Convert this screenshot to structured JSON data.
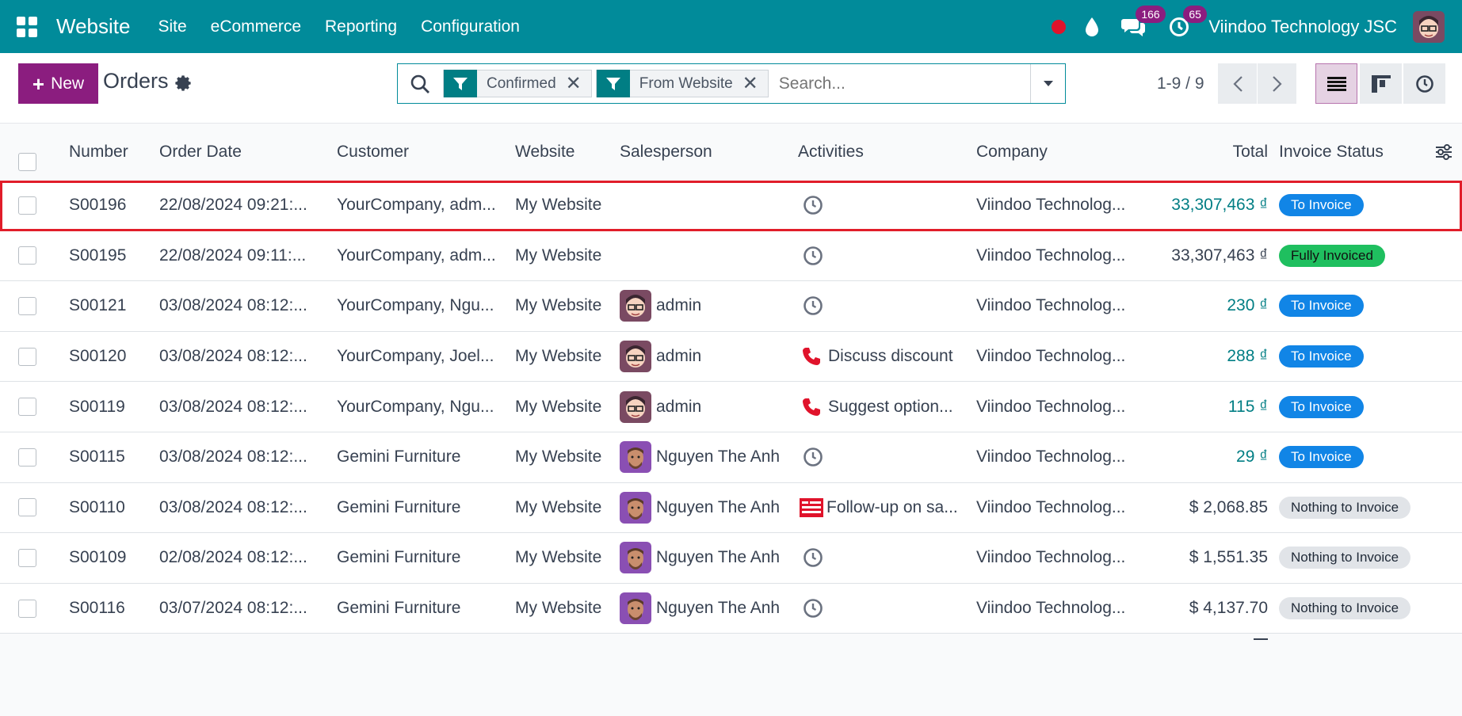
{
  "topbar": {
    "app_name": "Website",
    "menu": [
      "Site",
      "eCommerce",
      "Reporting",
      "Configuration"
    ],
    "messages_count": "166",
    "activities_count": "65",
    "company": "Viindoo Technology JSC",
    "brand_color": "#018b9a"
  },
  "control": {
    "new_label": "New",
    "title": "Orders",
    "facets": [
      "Confirmed",
      "From Website"
    ],
    "search_placeholder": "Search...",
    "pager": "1-9 / 9"
  },
  "table": {
    "headers": {
      "number": "Number",
      "order_date": "Order Date",
      "customer": "Customer",
      "website": "Website",
      "salesperson": "Salesperson",
      "activities": "Activities",
      "company": "Company",
      "total": "Total",
      "invoice_status": "Invoice Status"
    },
    "rows": [
      {
        "number": "S00196",
        "date": "22/08/2024 09:21:...",
        "customer": "YourCompany, adm...",
        "website": "My Website",
        "salesperson": "",
        "activity": "",
        "activity_icon": "clock-icon",
        "company": "Viindoo Technolog...",
        "total": "33,307,463 ₫",
        "total_link": true,
        "status": "To Invoice",
        "status_style": "blue",
        "highlight": true
      },
      {
        "number": "S00195",
        "date": "22/08/2024 09:11:...",
        "customer": "YourCompany, adm...",
        "website": "My Website",
        "salesperson": "",
        "activity": "",
        "activity_icon": "clock-icon",
        "company": "Viindoo Technolog...",
        "total": "33,307,463 ₫",
        "total_link": false,
        "status": "Fully Invoiced",
        "status_style": "green"
      },
      {
        "number": "S00121",
        "date": "03/08/2024 08:12:...",
        "customer": "YourCompany, Ngu...",
        "website": "My Website",
        "salesperson": "admin",
        "activity": "",
        "activity_icon": "clock-icon",
        "company": "Viindoo Technolog...",
        "total": "230 ₫",
        "total_link": true,
        "status": "To Invoice",
        "status_style": "blue"
      },
      {
        "number": "S00120",
        "date": "03/08/2024 08:12:...",
        "customer": "YourCompany, Joel...",
        "website": "My Website",
        "salesperson": "admin",
        "activity": "Discuss discount",
        "activity_icon": "phone-icon",
        "company": "Viindoo Technolog...",
        "total": "288 ₫",
        "total_link": true,
        "status": "To Invoice",
        "status_style": "blue"
      },
      {
        "number": "S00119",
        "date": "03/08/2024 08:12:...",
        "customer": "YourCompany, Ngu...",
        "website": "My Website",
        "salesperson": "admin",
        "activity": "Suggest option...",
        "activity_icon": "phone-icon",
        "company": "Viindoo Technolog...",
        "total": "115 ₫",
        "total_link": true,
        "status": "To Invoice",
        "status_style": "blue"
      },
      {
        "number": "S00115",
        "date": "03/08/2024 08:12:...",
        "customer": "Gemini Furniture",
        "website": "My Website",
        "salesperson": "Nguyen The Anh",
        "activity": "",
        "activity_icon": "clock-icon",
        "company": "Viindoo Technolog...",
        "total": "29 ₫",
        "total_link": true,
        "status": "To Invoice",
        "status_style": "blue"
      },
      {
        "number": "S00110",
        "date": "03/08/2024 08:12:...",
        "customer": "Gemini Furniture",
        "website": "My Website",
        "salesperson": "Nguyen The Anh",
        "activity": "Follow-up on sa...",
        "activity_icon": "mail-icon",
        "company": "Viindoo Technolog...",
        "total": "$ 2,068.85",
        "total_link": false,
        "status": "Nothing to Invoice",
        "status_style": "grey"
      },
      {
        "number": "S00109",
        "date": "02/08/2024 08:12:...",
        "customer": "Gemini Furniture",
        "website": "My Website",
        "salesperson": "Nguyen The Anh",
        "activity": "",
        "activity_icon": "clock-icon",
        "company": "Viindoo Technolog...",
        "total": "$ 1,551.35",
        "total_link": false,
        "status": "Nothing to Invoice",
        "status_style": "grey"
      },
      {
        "number": "S00116",
        "date": "03/07/2024 08:12:...",
        "customer": "Gemini Furniture",
        "website": "My Website",
        "salesperson": "Nguyen The Anh",
        "activity": "",
        "activity_icon": "clock-icon",
        "company": "Viindoo Technolog...",
        "total": "$ 4,137.70",
        "total_link": false,
        "status": "Nothing to Invoice",
        "status_style": "grey"
      }
    ]
  }
}
